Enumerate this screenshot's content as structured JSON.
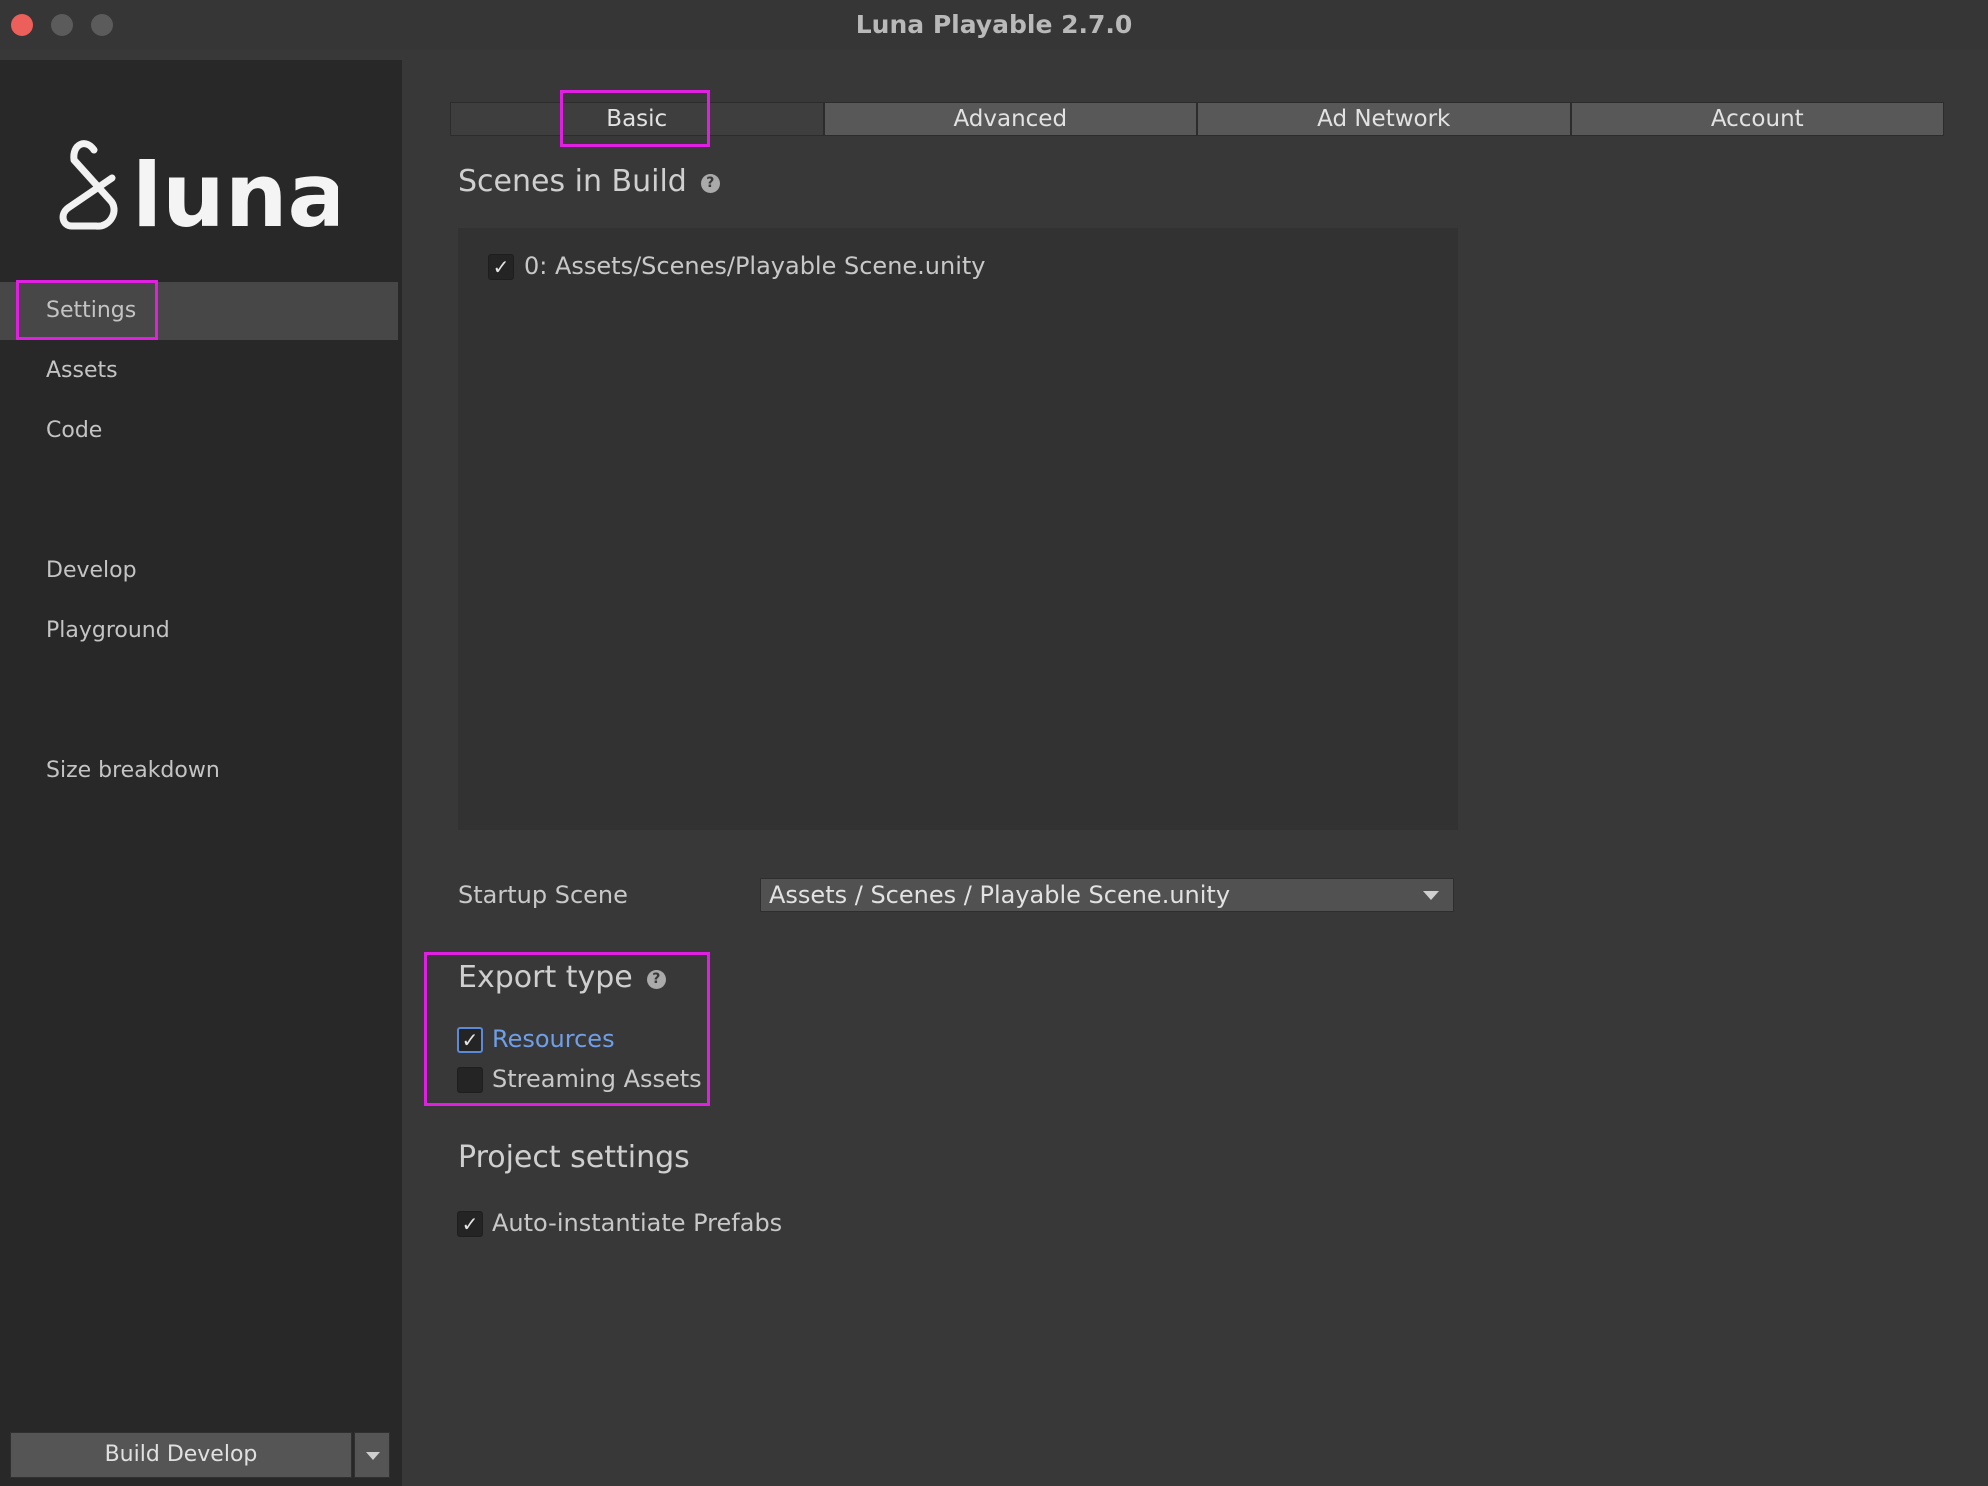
{
  "window": {
    "title": "Luna Playable 2.7.0"
  },
  "sidebar": {
    "logo_text": "luna",
    "items": [
      {
        "label": "Settings",
        "active": true
      },
      {
        "label": "Assets"
      },
      {
        "label": "Code"
      },
      {
        "label": "Develop"
      },
      {
        "label": "Playground"
      },
      {
        "label": "Size breakdown"
      }
    ],
    "build_button": "Build Develop"
  },
  "tabs": [
    {
      "label": "Basic",
      "active": true
    },
    {
      "label": "Advanced"
    },
    {
      "label": "Ad Network"
    },
    {
      "label": "Account"
    }
  ],
  "scenes": {
    "title": "Scenes in Build",
    "help_icon": "?",
    "items": [
      {
        "label": "0: Assets/Scenes/Playable Scene.unity",
        "checked": true
      }
    ]
  },
  "startup_scene": {
    "label": "Startup Scene",
    "value": "Assets / Scenes / Playable Scene.unity"
  },
  "export_type": {
    "title": "Export type",
    "help_icon": "?",
    "options": [
      {
        "label": "Resources",
        "checked": true
      },
      {
        "label": "Streaming Assets",
        "checked": false
      }
    ]
  },
  "project_settings": {
    "title": "Project settings",
    "options": [
      {
        "label": "Auto-instantiate Prefabs",
        "checked": true
      }
    ]
  },
  "colors": {
    "highlight": "#e020e0",
    "link_blue": "#6f9fe8",
    "close_button": "#ec5f5a"
  }
}
